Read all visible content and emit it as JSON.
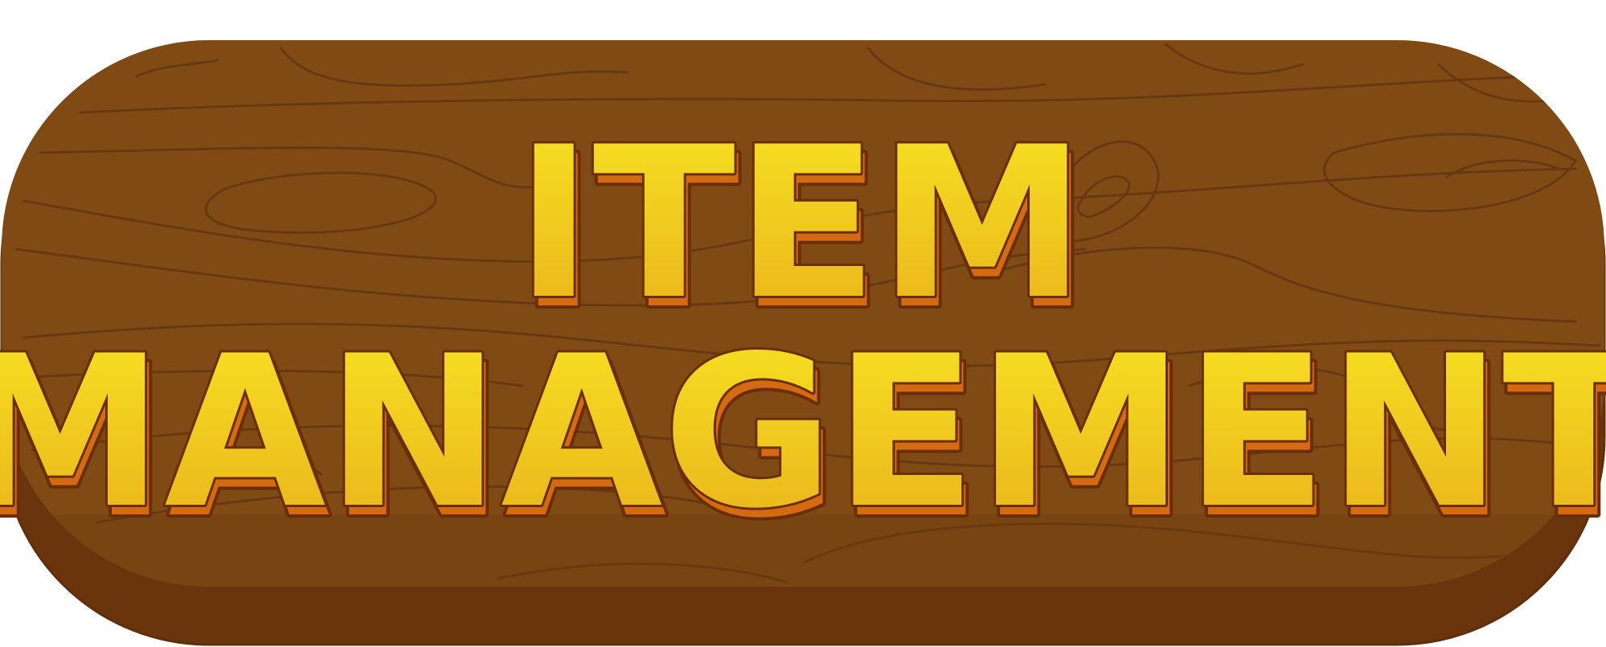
{
  "banner": {
    "title_line1": "ITEM",
    "title_line2": "MANAGEMENT"
  },
  "colors": {
    "wood_face": "#7f4a14",
    "wood_side": "#6a350c",
    "wood_edge": "#5e2f0b",
    "grain": "#5f3310",
    "text_fill_top": "#f7e423",
    "text_fill_bottom": "#e9b01b",
    "text_outline": "#6a2f0a",
    "text_shadow": "#d46a12",
    "background": "#ffffff"
  }
}
